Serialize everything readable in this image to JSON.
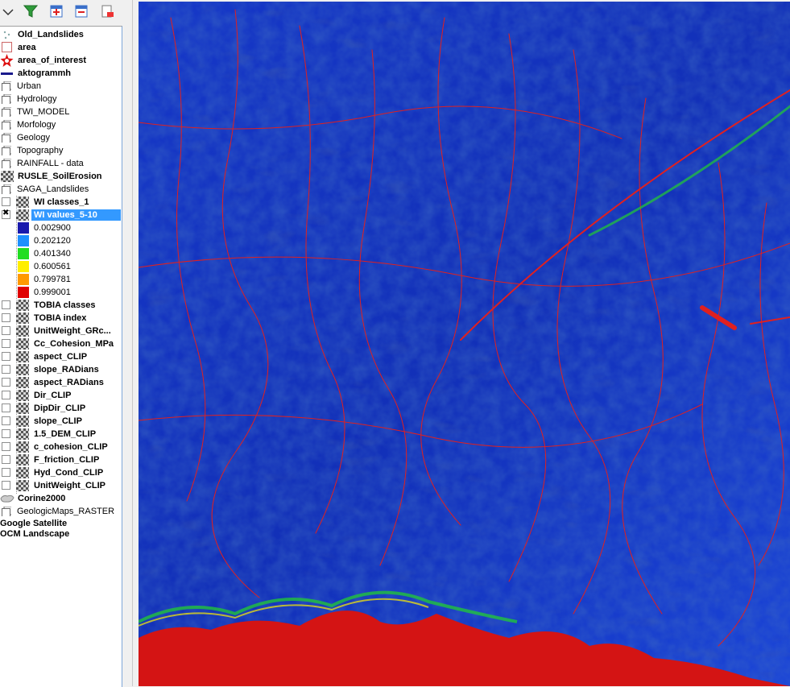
{
  "toolbar": {
    "buttons": [
      {
        "name": "dropdown-arrow-icon"
      },
      {
        "name": "filter-icon"
      },
      {
        "name": "expand-all-icon"
      },
      {
        "name": "collapse-all-icon"
      },
      {
        "name": "remove-layer-icon"
      }
    ]
  },
  "colors": {
    "accent_selected": "#3399ff",
    "legend": [
      "#1a1aad",
      "#1e90ff",
      "#22dd22",
      "#ffee00",
      "#ff9900",
      "#e00000"
    ],
    "map_base": "#1133cc",
    "map_high": "#dd0000"
  },
  "layers": {
    "old_landslides": "Old_Landslides",
    "area": "area",
    "area_of_interest": "area_of_interest",
    "aktogrammh": "aktogrammh",
    "urban": "Urban",
    "hydrology": "Hydrology",
    "twi_model": "TWI_MODEL",
    "morfology": "Morfology",
    "geology": "Geology",
    "topography": "Topography",
    "rainfall": "RAINFALL - data",
    "rusle": "RUSLE_SoilErosion",
    "saga": "SAGA_Landslides",
    "wi_classes": "WI classes_1",
    "wi_values": "WI values_5-10",
    "legend_values": [
      "0.002900",
      "0.202120",
      "0.401340",
      "0.600561",
      "0.799781",
      "0.999001"
    ],
    "saga_children": [
      "TOBIA classes",
      "TOBIA index",
      "UnitWeight_GRc...",
      "Cc_Cohesion_MPa",
      "aspect_CLIP",
      "slope_RADians",
      "aspect_RADians",
      "Dir_CLIP",
      "DipDir_CLIP",
      "slope_CLIP",
      "1.5_DEM_CLIP",
      "c_cohesion_CLIP",
      "F_friction_CLIP",
      "Hyd_Cond_CLIP",
      "UnitWeight_CLIP"
    ],
    "corine": "Corine2000",
    "geologic_maps": "GeologicMaps_RASTER",
    "google_satellite": "Google Satellite",
    "ocm_landscape": "OCM Landscape"
  }
}
